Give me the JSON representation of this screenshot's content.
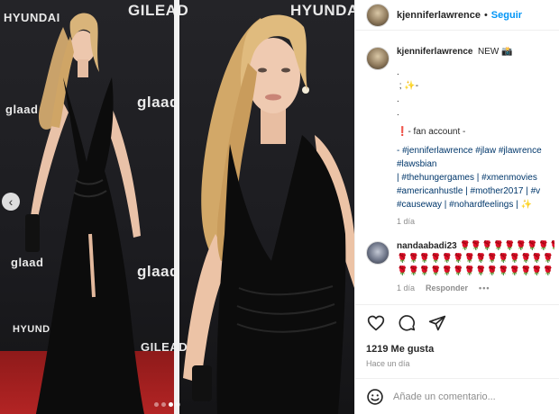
{
  "post": {
    "username": "kjenniferlawrence",
    "separator": "•",
    "follow_label": "Seguir"
  },
  "media": {
    "sponsors_left": [
      "HYUNDAI",
      "glaad",
      "glaad",
      "HYUNDAI"
    ],
    "sponsors_right": [
      "GILEAD",
      "HYUNDAI",
      "glaad",
      "glaad",
      "GILEAD"
    ],
    "carousel_dots": 4,
    "active_dot": 2,
    "prev_arrow": "‹"
  },
  "caption": {
    "username": "kjenniferlawrence",
    "headline": "⁠⁠⁠ NEW 📸",
    "lines": [
      ".",
      " ; ✨-",
      ".",
      "."
    ],
    "fan_line": "❗- fan account -",
    "tags": [
      "- #jenniferlawrence #jlaw #jlawrence",
      "#lawsbian",
      "| #thehungergames | #xmenmovies",
      "#americanhustle | #mother2017 | #v",
      "#causeway | #nohardfeelings | ✨"
    ],
    "time": "1 día"
  },
  "reply": {
    "username": "nandaabadi23",
    "roses": [
      "🌹🌹🌹🌹🌹🌹🌹🌹🌹🌹🌹",
      "🌹🌹🌹🌹🌹🌹🌹🌹🌹🌹🌹🌹🌹🌹🌹",
      "🌹🌹🌹🌹🌹🌹🌹🌹🌹🌹🌹🌹🌹🌹🌹"
    ],
    "time": "1 día",
    "reply_label": "Responder",
    "more_label": "•••"
  },
  "stats": {
    "likes": "1219 Me gusta",
    "ago": "Hace un día"
  },
  "composer": {
    "placeholder": "Añade un comentario..."
  },
  "icons": {
    "like": "heart-icon",
    "comment": "comment-icon",
    "share": "share-icon",
    "emoji": "emoji-icon",
    "prev": "chevron-left-icon"
  },
  "colors": {
    "accent": "#0095f6",
    "text": "#262626",
    "muted": "#8e8e8e",
    "carpet": "#b32424",
    "dress": "#0c0c0c"
  }
}
